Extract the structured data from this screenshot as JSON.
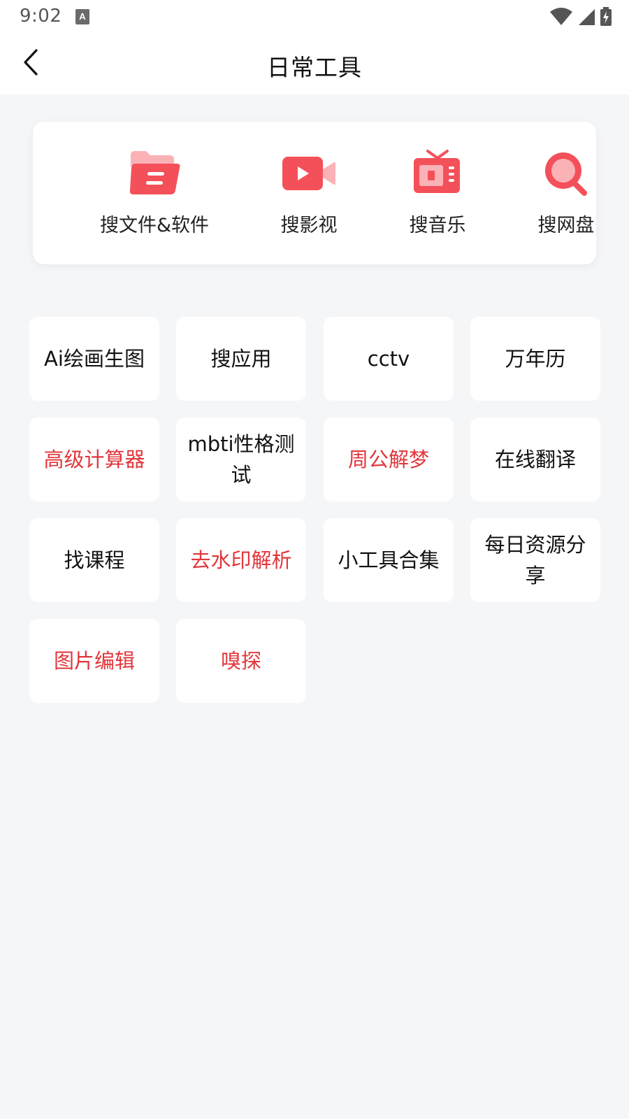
{
  "status_bar": {
    "time": "9:02"
  },
  "header": {
    "title": "日常工具",
    "back_icon": "chevron-left-icon"
  },
  "search_tools": [
    {
      "label": "搜文件&软件",
      "icon": "folder-icon"
    },
    {
      "label": "搜影视",
      "icon": "video-camera-icon"
    },
    {
      "label": "搜音乐",
      "icon": "tv-icon"
    },
    {
      "label": "搜网盘",
      "icon": "magnifier-icon"
    }
  ],
  "tools": [
    {
      "label": "Ai绘画生图",
      "highlight": false
    },
    {
      "label": "搜应用",
      "highlight": false
    },
    {
      "label": "cctv",
      "highlight": false
    },
    {
      "label": "万年历",
      "highlight": false
    },
    {
      "label": "高级计算器",
      "highlight": true
    },
    {
      "label": "mbti性格测试",
      "highlight": false
    },
    {
      "label": "周公解梦",
      "highlight": true
    },
    {
      "label": "在线翻译",
      "highlight": false
    },
    {
      "label": "找课程",
      "highlight": false
    },
    {
      "label": "去水印解析",
      "highlight": true
    },
    {
      "label": "小工具合集",
      "highlight": false
    },
    {
      "label": "每日资源分享",
      "highlight": false
    },
    {
      "label": "图片编辑",
      "highlight": true
    },
    {
      "label": "嗅探",
      "highlight": true
    }
  ],
  "colors": {
    "accent_red": "#e2363c",
    "icon_red": "#f4505a",
    "icon_pink": "#fbb2b7",
    "background": "#f5f6f8"
  }
}
